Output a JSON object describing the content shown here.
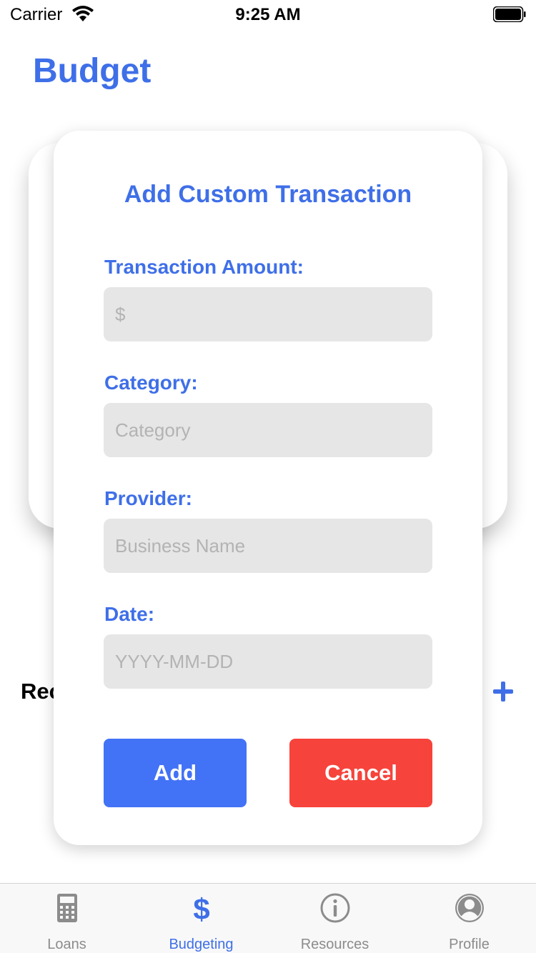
{
  "status_bar": {
    "carrier": "Carrier",
    "time": "9:25 AM"
  },
  "page": {
    "title": "Budget"
  },
  "background": {
    "recent_label": "Rec"
  },
  "modal": {
    "title": "Add Custom Transaction",
    "fields": [
      {
        "label": "Transaction Amount:",
        "placeholder": "$",
        "value": ""
      },
      {
        "label": "Category:",
        "placeholder": "Category",
        "value": ""
      },
      {
        "label": "Provider:",
        "placeholder": "Business Name",
        "value": ""
      },
      {
        "label": "Date:",
        "placeholder": "YYYY-MM-DD",
        "value": ""
      }
    ],
    "add_label": "Add",
    "cancel_label": "Cancel"
  },
  "tabs": [
    {
      "label": "Loans",
      "icon": "calculator-icon",
      "active": false
    },
    {
      "label": "Budgeting",
      "icon": "dollar-icon",
      "active": true
    },
    {
      "label": "Resources",
      "icon": "info-icon",
      "active": false
    },
    {
      "label": "Profile",
      "icon": "profile-icon",
      "active": false
    }
  ],
  "colors": {
    "accent": "#3f6fe8",
    "add_button": "#4272f6",
    "cancel_button": "#f6433b",
    "input_bg": "#e6e6e6",
    "tab_inactive": "#8c8c8c"
  }
}
